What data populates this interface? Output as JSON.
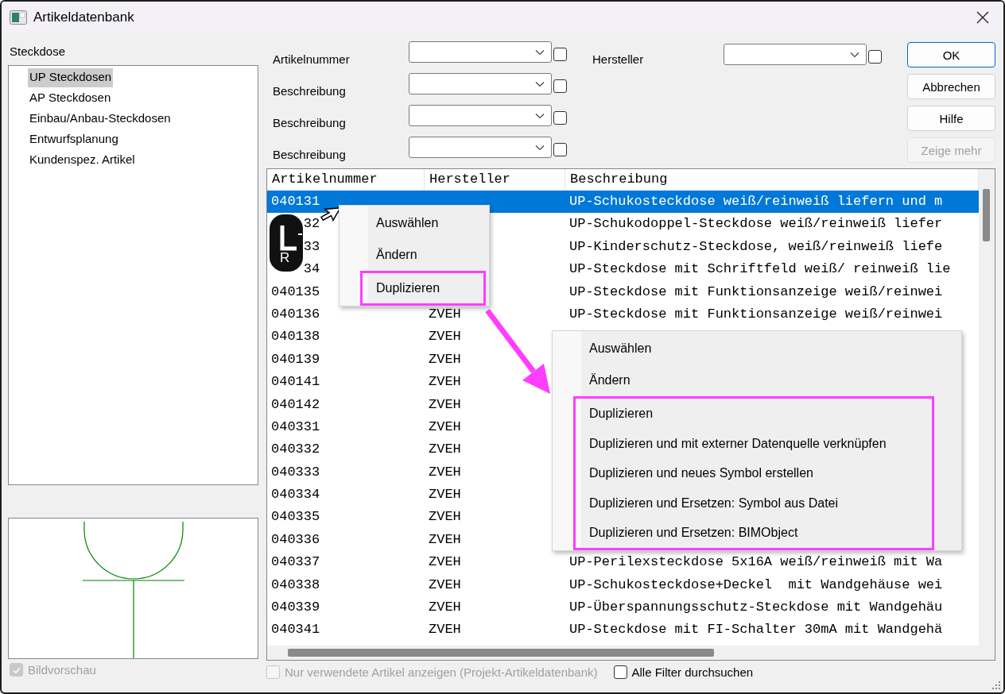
{
  "window": {
    "title": "Artikeldatenbank"
  },
  "category": {
    "label": "Steckdose",
    "items": [
      {
        "label": "UP Steckdosen",
        "selected": true
      },
      {
        "label": "AP Steckdosen",
        "selected": false
      },
      {
        "label": "Einbau/Anbau-Steckdosen",
        "selected": false
      },
      {
        "label": "Entwurfsplanung",
        "selected": false
      },
      {
        "label": "Kundenspez. Artikel",
        "selected": false
      }
    ]
  },
  "preview": {
    "option": {
      "label": "Bildvorschau",
      "checked": true,
      "disabled": true
    }
  },
  "filters": [
    {
      "label": "Artikelnummer",
      "checked": false
    },
    {
      "label": "Beschreibung",
      "checked": false
    },
    {
      "label": "Beschreibung",
      "checked": false
    },
    {
      "label": "Beschreibung",
      "checked": false
    }
  ],
  "maker_filter": {
    "label": "Hersteller",
    "checked": false
  },
  "buttons": [
    {
      "label": "OK",
      "kind": "default",
      "disabled": false
    },
    {
      "label": "Abbrechen",
      "kind": "normal",
      "disabled": false
    },
    {
      "label": "Hilfe",
      "kind": "normal",
      "disabled": false
    },
    {
      "label": "Zeige mehr",
      "kind": "normal",
      "disabled": true
    }
  ],
  "table": {
    "columns": [
      "Artikelnummer",
      "Hersteller",
      "Beschreibung"
    ],
    "rows": [
      {
        "number": "040131",
        "description": "UP-Schukosteckdose weiß/reinweiß liefern und m",
        "selected": true
      },
      {
        "number": "32",
        "description": "UP-Schukodoppel-Steckdose weiß/reinweiß liefer",
        "selected": false
      },
      {
        "number": "33",
        "description": "UP-Kinderschutz-Steckdose, weiß/reinweiß liefe",
        "selected": false
      },
      {
        "number": "34",
        "description": "UP-Steckdose mit Schriftfeld weiß/ reinweiß lie",
        "selected": false
      },
      {
        "number": "040135",
        "description": "UP-Steckdose mit Funktionsanzeige weiß/reinwei",
        "selected": false
      },
      {
        "number": "040136",
        "maker": "ZVEH",
        "description": "UP-Steckdose mit Funktionsanzeige weiß/reinwei",
        "selected": false
      },
      {
        "number": "040138",
        "maker": "ZVEH",
        "selected": false
      },
      {
        "number": "040139",
        "maker": "ZVEH",
        "selected": false
      },
      {
        "number": "040141",
        "maker": "ZVEH",
        "selected": false
      },
      {
        "number": "040142",
        "maker": "ZVEH",
        "selected": false
      },
      {
        "number": "040331",
        "maker": "ZVEH",
        "selected": false
      },
      {
        "number": "040332",
        "maker": "ZVEH",
        "selected": false
      },
      {
        "number": "040333",
        "maker": "ZVEH",
        "selected": false
      },
      {
        "number": "040334",
        "maker": "ZVEH",
        "selected": false
      },
      {
        "number": "040335",
        "maker": "ZVEH",
        "selected": false
      },
      {
        "number": "040336",
        "maker": "ZVEH",
        "selected": false
      },
      {
        "number": "040337",
        "maker": "ZVEH",
        "description": "UP-Perilexsteckdose 5x16A weiß/reinweiß mit Wa",
        "selected": false
      },
      {
        "number": "040338",
        "maker": "ZVEH",
        "description": "UP-Schukosteckdose+Deckel  mit Wandgehäuse wei",
        "selected": false
      },
      {
        "number": "040339",
        "maker": "ZVEH",
        "description": "UP-Überspannungsschutz-Steckdose mit Wandgehäu",
        "selected": false
      },
      {
        "number": "040341",
        "maker": "ZVEH",
        "description": "UP-Steckdose mit FI-Schalter 30mA mit Wandgehä",
        "selected": false
      }
    ]
  },
  "options": [
    {
      "label": "Nur verwendete Artikel anzeigen (Projekt-Artikeldatenbank)",
      "checked": false,
      "disabled": true
    },
    {
      "label": "Alle Filter durchsuchen",
      "checked": false,
      "disabled": false
    }
  ],
  "context_menus": [
    {
      "items": [
        {
          "label": "Auswählen",
          "framed": false
        },
        {
          "label": "Ändern",
          "framed": false
        },
        {
          "label": "Duplizieren",
          "framed": true
        }
      ]
    },
    {
      "items": [
        {
          "label": "Auswählen",
          "framed": false
        },
        {
          "label": "Ändern",
          "framed": false
        },
        {
          "label": "Duplizieren",
          "framed": true
        },
        {
          "label": "Duplizieren und mit externer Datenquelle verknüpfen",
          "framed": true
        },
        {
          "label": "Duplizieren und neues Symbol erstellen",
          "framed": true
        },
        {
          "label": "Duplizieren und Ersetzen: Symbol aus Datei",
          "framed": true
        },
        {
          "label": "Duplizieren und Ersetzen: BIMObject",
          "framed": true
        }
      ]
    }
  ],
  "mouse_badge": {
    "label": "R"
  }
}
